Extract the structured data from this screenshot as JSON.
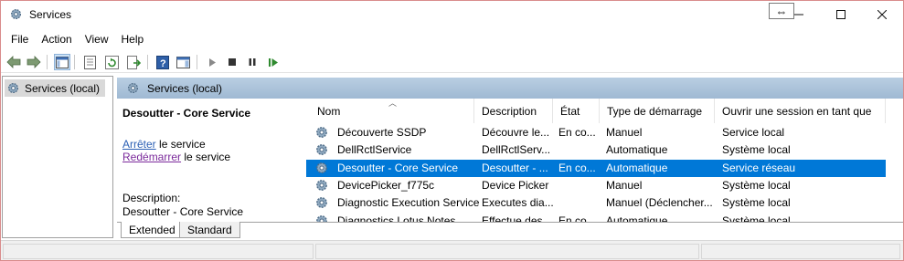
{
  "window": {
    "title": "Services"
  },
  "menu": [
    "File",
    "Action",
    "View",
    "Help"
  ],
  "tree": {
    "root_label": "Services (local)"
  },
  "panel": {
    "header": "Services (local)",
    "selected_service_name": "Desoutter - Core Service",
    "stop_link": "Arrêter",
    "stop_suffix": " le service",
    "restart_link": "Redémarrer",
    "restart_suffix": " le service",
    "description_label": "Description:",
    "description_text": "Desoutter - Core Service"
  },
  "columns": [
    "Nom",
    "Description",
    "État",
    "Type de démarrage",
    "Ouvrir une session en tant que"
  ],
  "services": [
    {
      "name": "Découverte SSDP",
      "description": "Découvre le...",
      "state": "En co...",
      "startup": "Manuel",
      "logon": "Service local",
      "selected": false
    },
    {
      "name": "DellRctlService",
      "description": "DellRctlServ...",
      "state": "",
      "startup": "Automatique",
      "logon": "Système local",
      "selected": false
    },
    {
      "name": "Desoutter - Core Service",
      "description": "Desoutter - ...",
      "state": "En co...",
      "startup": "Automatique",
      "logon": "Service réseau",
      "selected": true
    },
    {
      "name": "DevicePicker_f775c",
      "description": "Device Picker",
      "state": "",
      "startup": "Manuel",
      "logon": "Système local",
      "selected": false
    },
    {
      "name": "Diagnostic Execution Service",
      "description": "Executes dia...",
      "state": "",
      "startup": "Manuel (Déclencher...",
      "logon": "Système local",
      "selected": false
    },
    {
      "name": "Diagnostics Lotus Notes",
      "description": "Effectue des...",
      "state": "En co...",
      "startup": "Automatique",
      "logon": "Système local",
      "selected": false
    }
  ],
  "tabs": {
    "extended": "Extended",
    "standard": "Standard"
  },
  "colors": {
    "selection": "#0078d7",
    "header_blue": "#a9c2da",
    "link": "#2b5fb4",
    "visited_link": "#7b2a9b"
  }
}
